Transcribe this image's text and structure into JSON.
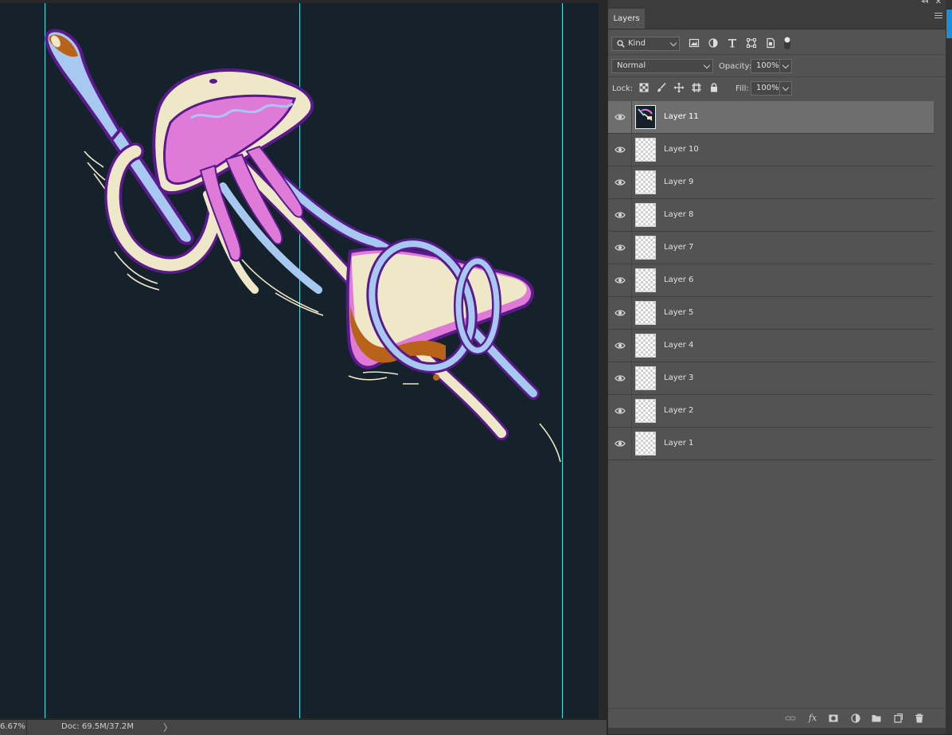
{
  "status_bar": {
    "zoom": "6.67%",
    "doc": "Doc: 69.5M/37.2M",
    "arrow": "〉"
  },
  "panel": {
    "tab_label": "Layers",
    "filter": {
      "kind_label": "Kind"
    },
    "blend": {
      "mode": "Normal",
      "opacity_label": "Opacity:",
      "opacity_value": "100%"
    },
    "lock": {
      "label": "Lock:",
      "fill_label": "Fill:",
      "fill_value": "100%"
    },
    "layers": [
      {
        "name": "Layer 11",
        "selected": true,
        "thumb": "artwork"
      },
      {
        "name": "Layer 10",
        "selected": false,
        "thumb": "transparent"
      },
      {
        "name": "Layer 9",
        "selected": false,
        "thumb": "transparent"
      },
      {
        "name": "Layer 8",
        "selected": false,
        "thumb": "transparent"
      },
      {
        "name": "Layer 7",
        "selected": false,
        "thumb": "transparent"
      },
      {
        "name": "Layer 6",
        "selected": false,
        "thumb": "transparent"
      },
      {
        "name": "Layer 5",
        "selected": false,
        "thumb": "transparent"
      },
      {
        "name": "Layer 4",
        "selected": false,
        "thumb": "transparent"
      },
      {
        "name": "Layer 3",
        "selected": false,
        "thumb": "transparent"
      },
      {
        "name": "Layer 2",
        "selected": false,
        "thumb": "transparent"
      },
      {
        "name": "Layer 1",
        "selected": false,
        "thumb": "transparent"
      }
    ]
  },
  "colors": {
    "canvas_bg": "#15222c",
    "guide": "#3ee0e6",
    "panel_bg": "#535353",
    "selected_row": "#6e6e6e",
    "art_pink": "#e07ad8",
    "art_cream": "#efe8c8",
    "art_blue": "#a7c8f0",
    "art_purple": "#5a1a8c",
    "art_brown": "#b8621a"
  }
}
